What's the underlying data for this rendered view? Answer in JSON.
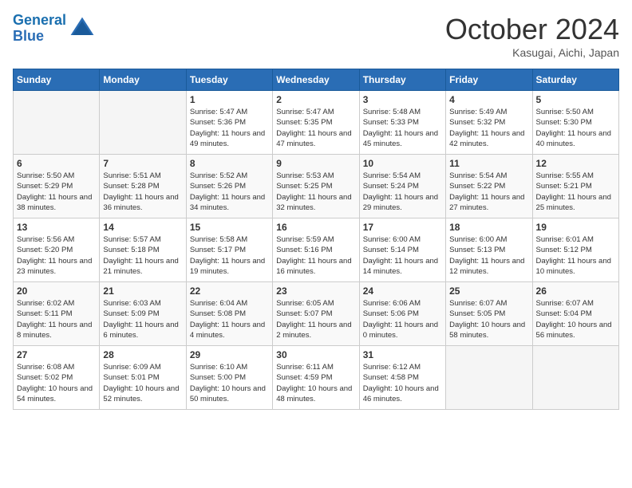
{
  "logo": {
    "line1": "General",
    "line2": "Blue"
  },
  "title": "October 2024",
  "location": "Kasugai, Aichi, Japan",
  "days_of_week": [
    "Sunday",
    "Monday",
    "Tuesday",
    "Wednesday",
    "Thursday",
    "Friday",
    "Saturday"
  ],
  "weeks": [
    [
      {
        "day": "",
        "info": ""
      },
      {
        "day": "",
        "info": ""
      },
      {
        "day": "1",
        "info": "Sunrise: 5:47 AM\nSunset: 5:36 PM\nDaylight: 11 hours and 49 minutes."
      },
      {
        "day": "2",
        "info": "Sunrise: 5:47 AM\nSunset: 5:35 PM\nDaylight: 11 hours and 47 minutes."
      },
      {
        "day": "3",
        "info": "Sunrise: 5:48 AM\nSunset: 5:33 PM\nDaylight: 11 hours and 45 minutes."
      },
      {
        "day": "4",
        "info": "Sunrise: 5:49 AM\nSunset: 5:32 PM\nDaylight: 11 hours and 42 minutes."
      },
      {
        "day": "5",
        "info": "Sunrise: 5:50 AM\nSunset: 5:30 PM\nDaylight: 11 hours and 40 minutes."
      }
    ],
    [
      {
        "day": "6",
        "info": "Sunrise: 5:50 AM\nSunset: 5:29 PM\nDaylight: 11 hours and 38 minutes."
      },
      {
        "day": "7",
        "info": "Sunrise: 5:51 AM\nSunset: 5:28 PM\nDaylight: 11 hours and 36 minutes."
      },
      {
        "day": "8",
        "info": "Sunrise: 5:52 AM\nSunset: 5:26 PM\nDaylight: 11 hours and 34 minutes."
      },
      {
        "day": "9",
        "info": "Sunrise: 5:53 AM\nSunset: 5:25 PM\nDaylight: 11 hours and 32 minutes."
      },
      {
        "day": "10",
        "info": "Sunrise: 5:54 AM\nSunset: 5:24 PM\nDaylight: 11 hours and 29 minutes."
      },
      {
        "day": "11",
        "info": "Sunrise: 5:54 AM\nSunset: 5:22 PM\nDaylight: 11 hours and 27 minutes."
      },
      {
        "day": "12",
        "info": "Sunrise: 5:55 AM\nSunset: 5:21 PM\nDaylight: 11 hours and 25 minutes."
      }
    ],
    [
      {
        "day": "13",
        "info": "Sunrise: 5:56 AM\nSunset: 5:20 PM\nDaylight: 11 hours and 23 minutes."
      },
      {
        "day": "14",
        "info": "Sunrise: 5:57 AM\nSunset: 5:18 PM\nDaylight: 11 hours and 21 minutes."
      },
      {
        "day": "15",
        "info": "Sunrise: 5:58 AM\nSunset: 5:17 PM\nDaylight: 11 hours and 19 minutes."
      },
      {
        "day": "16",
        "info": "Sunrise: 5:59 AM\nSunset: 5:16 PM\nDaylight: 11 hours and 16 minutes."
      },
      {
        "day": "17",
        "info": "Sunrise: 6:00 AM\nSunset: 5:14 PM\nDaylight: 11 hours and 14 minutes."
      },
      {
        "day": "18",
        "info": "Sunrise: 6:00 AM\nSunset: 5:13 PM\nDaylight: 11 hours and 12 minutes."
      },
      {
        "day": "19",
        "info": "Sunrise: 6:01 AM\nSunset: 5:12 PM\nDaylight: 11 hours and 10 minutes."
      }
    ],
    [
      {
        "day": "20",
        "info": "Sunrise: 6:02 AM\nSunset: 5:11 PM\nDaylight: 11 hours and 8 minutes."
      },
      {
        "day": "21",
        "info": "Sunrise: 6:03 AM\nSunset: 5:09 PM\nDaylight: 11 hours and 6 minutes."
      },
      {
        "day": "22",
        "info": "Sunrise: 6:04 AM\nSunset: 5:08 PM\nDaylight: 11 hours and 4 minutes."
      },
      {
        "day": "23",
        "info": "Sunrise: 6:05 AM\nSunset: 5:07 PM\nDaylight: 11 hours and 2 minutes."
      },
      {
        "day": "24",
        "info": "Sunrise: 6:06 AM\nSunset: 5:06 PM\nDaylight: 11 hours and 0 minutes."
      },
      {
        "day": "25",
        "info": "Sunrise: 6:07 AM\nSunset: 5:05 PM\nDaylight: 10 hours and 58 minutes."
      },
      {
        "day": "26",
        "info": "Sunrise: 6:07 AM\nSunset: 5:04 PM\nDaylight: 10 hours and 56 minutes."
      }
    ],
    [
      {
        "day": "27",
        "info": "Sunrise: 6:08 AM\nSunset: 5:02 PM\nDaylight: 10 hours and 54 minutes."
      },
      {
        "day": "28",
        "info": "Sunrise: 6:09 AM\nSunset: 5:01 PM\nDaylight: 10 hours and 52 minutes."
      },
      {
        "day": "29",
        "info": "Sunrise: 6:10 AM\nSunset: 5:00 PM\nDaylight: 10 hours and 50 minutes."
      },
      {
        "day": "30",
        "info": "Sunrise: 6:11 AM\nSunset: 4:59 PM\nDaylight: 10 hours and 48 minutes."
      },
      {
        "day": "31",
        "info": "Sunrise: 6:12 AM\nSunset: 4:58 PM\nDaylight: 10 hours and 46 minutes."
      },
      {
        "day": "",
        "info": ""
      },
      {
        "day": "",
        "info": ""
      }
    ]
  ]
}
